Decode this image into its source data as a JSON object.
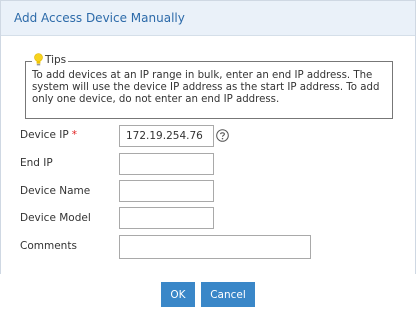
{
  "dialog": {
    "title": "Add Access Device Manually"
  },
  "tips": {
    "label": "Tips",
    "lines": [
      "To add devices at an IP range in bulk, enter an end IP address. The",
      "system will use the device IP address as the start IP address. To add",
      "only one device, do not enter an end IP address."
    ]
  },
  "form": {
    "device_ip": {
      "label": "Device IP",
      "required_mark": "*",
      "value": "172.19.254.76"
    },
    "end_ip": {
      "label": "End IP",
      "value": ""
    },
    "device_name": {
      "label": "Device Name",
      "value": ""
    },
    "device_model": {
      "label": "Device Model",
      "value": ""
    },
    "comments": {
      "label": "Comments",
      "value": ""
    }
  },
  "buttons": {
    "ok": "OK",
    "cancel": "Cancel"
  },
  "colors": {
    "title_text": "#2c6aa9",
    "titlebar_bg": "#eaf1f9",
    "button_bg": "#3a87c8",
    "required": "#e02020"
  },
  "icons": {
    "tips": "lightbulb-icon",
    "help": "question-circle-icon"
  }
}
